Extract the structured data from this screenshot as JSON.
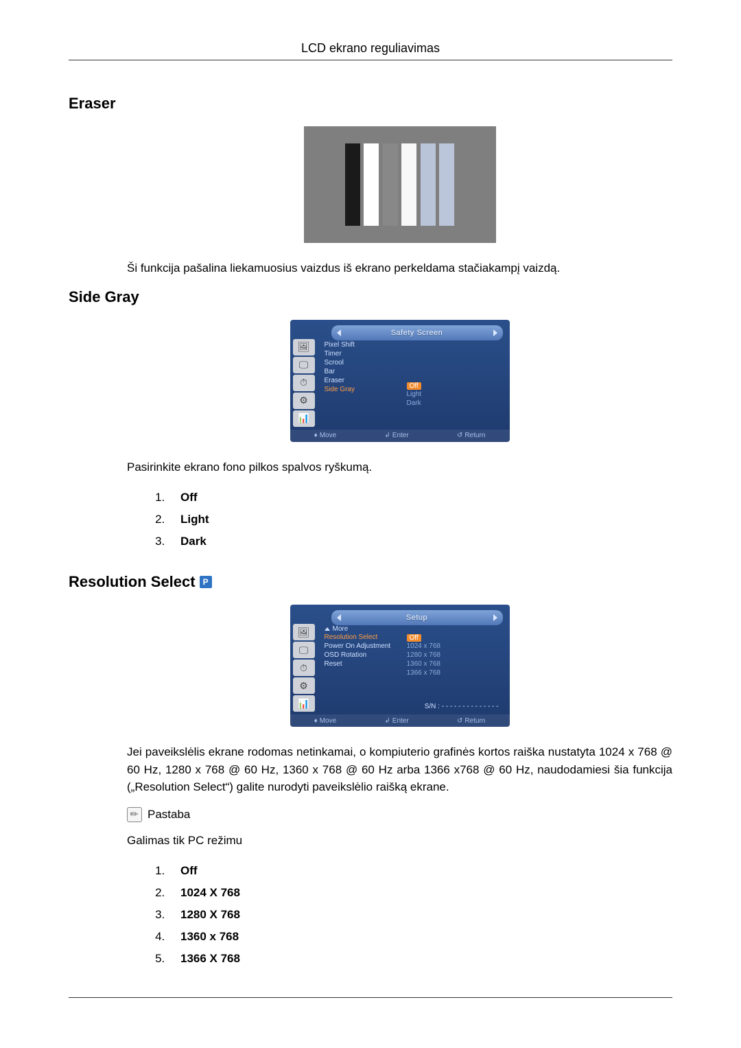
{
  "header": {
    "title": "LCD ekrano reguliavimas"
  },
  "eraser": {
    "title": "Eraser",
    "desc": "Ši funkcija pašalina liekamuosius vaizdus iš ekrano perkeldama stačiakampį vaizdą."
  },
  "sideGray": {
    "title": "Side Gray",
    "desc": "Pasirinkite ekrano fono pilkos spalvos ryškumą.",
    "items": [
      "Off",
      "Light",
      "Dark"
    ],
    "osd": {
      "header": "Safety Screen",
      "menu": [
        "Pixel Shift",
        "Timer",
        "Scrool",
        "Bar",
        "Eraser",
        "Side Gray"
      ],
      "activeIndex": 5,
      "options": [
        "Off",
        "Light",
        "Dark"
      ],
      "footer": {
        "move": "Move",
        "enter": "Enter",
        "return": "Return"
      }
    }
  },
  "resolution": {
    "title": "Resolution Select",
    "desc": "Jei paveikslėlis ekrane rodomas netinkamai, o kompiuterio grafinės kortos raiška nustatyta 1024 x 768 @ 60 Hz, 1280 x 768 @ 60 Hz, 1360 x 768 @ 60 Hz arba 1366 x768 @ 60 Hz, naudodamiesi šia funkcija („Resolution Select“) galite nurodyti paveikslėlio raišką ekrane.",
    "noteLabel": "Pastaba",
    "availability": "Galimas tik PC režimu",
    "items": [
      "Off",
      "1024 X 768",
      "1280 X 768",
      "1360 x 768",
      "1366 X 768"
    ],
    "osd": {
      "header": "Setup",
      "moreLabel": "More",
      "menu": [
        "Resolution Select",
        "Power On Adjustment",
        "OSD Rotation",
        "Reset"
      ],
      "activeIndex": 0,
      "options": [
        "Off",
        "1024 x 768",
        "1280 x 768",
        "1360 x 768",
        "1366 x 768"
      ],
      "snLabel": "S/N :",
      "snValue": "- - - - - - - - - - - - - -",
      "footer": {
        "move": "Move",
        "enter": "Enter",
        "return": "Return"
      }
    }
  }
}
